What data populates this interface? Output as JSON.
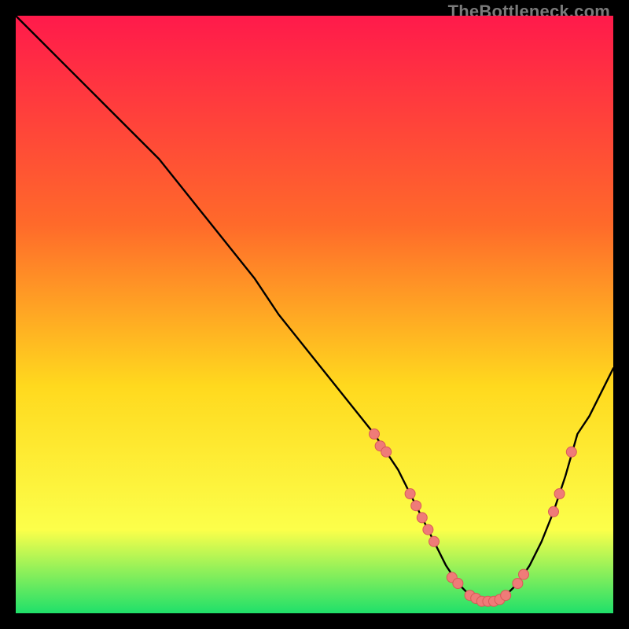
{
  "watermark": "TheBottleneck.com",
  "colors": {
    "bg": "#000000",
    "gradient_top": "#ff1a4b",
    "gradient_mid1": "#ff6a2a",
    "gradient_mid2": "#ffd91e",
    "gradient_mid3": "#fcff4a",
    "gradient_bottom": "#1fe06a",
    "curve": "#000000",
    "marker_fill": "#ef7b78",
    "marker_stroke": "#d85a57"
  },
  "chart_data": {
    "type": "line",
    "title": "",
    "xlabel": "",
    "ylabel": "",
    "xlim": [
      0,
      100
    ],
    "ylim": [
      0,
      100
    ],
    "series": [
      {
        "name": "bottleneck-curve",
        "x": [
          0,
          4,
          8,
          12,
          16,
          20,
          24,
          28,
          32,
          36,
          40,
          44,
          48,
          52,
          56,
          60,
          62,
          64,
          66,
          68,
          70,
          72,
          74,
          76,
          78,
          80,
          82,
          84,
          86,
          88,
          90,
          92,
          94,
          96,
          98,
          100
        ],
        "y": [
          100,
          96,
          92,
          88,
          84,
          80,
          76,
          71,
          66,
          61,
          56,
          50,
          45,
          40,
          35,
          30,
          27,
          24,
          20,
          16,
          12,
          8,
          5,
          3,
          2,
          2,
          3,
          5,
          8,
          12,
          17,
          23,
          30,
          33,
          37,
          41
        ]
      }
    ],
    "markers": [
      {
        "x": 60,
        "y": 30
      },
      {
        "x": 61,
        "y": 28
      },
      {
        "x": 62,
        "y": 27
      },
      {
        "x": 66,
        "y": 20
      },
      {
        "x": 67,
        "y": 18
      },
      {
        "x": 68,
        "y": 16
      },
      {
        "x": 69,
        "y": 14
      },
      {
        "x": 70,
        "y": 12
      },
      {
        "x": 73,
        "y": 6
      },
      {
        "x": 74,
        "y": 5
      },
      {
        "x": 76,
        "y": 3
      },
      {
        "x": 77,
        "y": 2.5
      },
      {
        "x": 78,
        "y": 2
      },
      {
        "x": 79,
        "y": 2
      },
      {
        "x": 80,
        "y": 2
      },
      {
        "x": 81,
        "y": 2.3
      },
      {
        "x": 82,
        "y": 3
      },
      {
        "x": 84,
        "y": 5
      },
      {
        "x": 85,
        "y": 6.5
      },
      {
        "x": 90,
        "y": 17
      },
      {
        "x": 91,
        "y": 20
      },
      {
        "x": 93,
        "y": 27
      }
    ]
  }
}
